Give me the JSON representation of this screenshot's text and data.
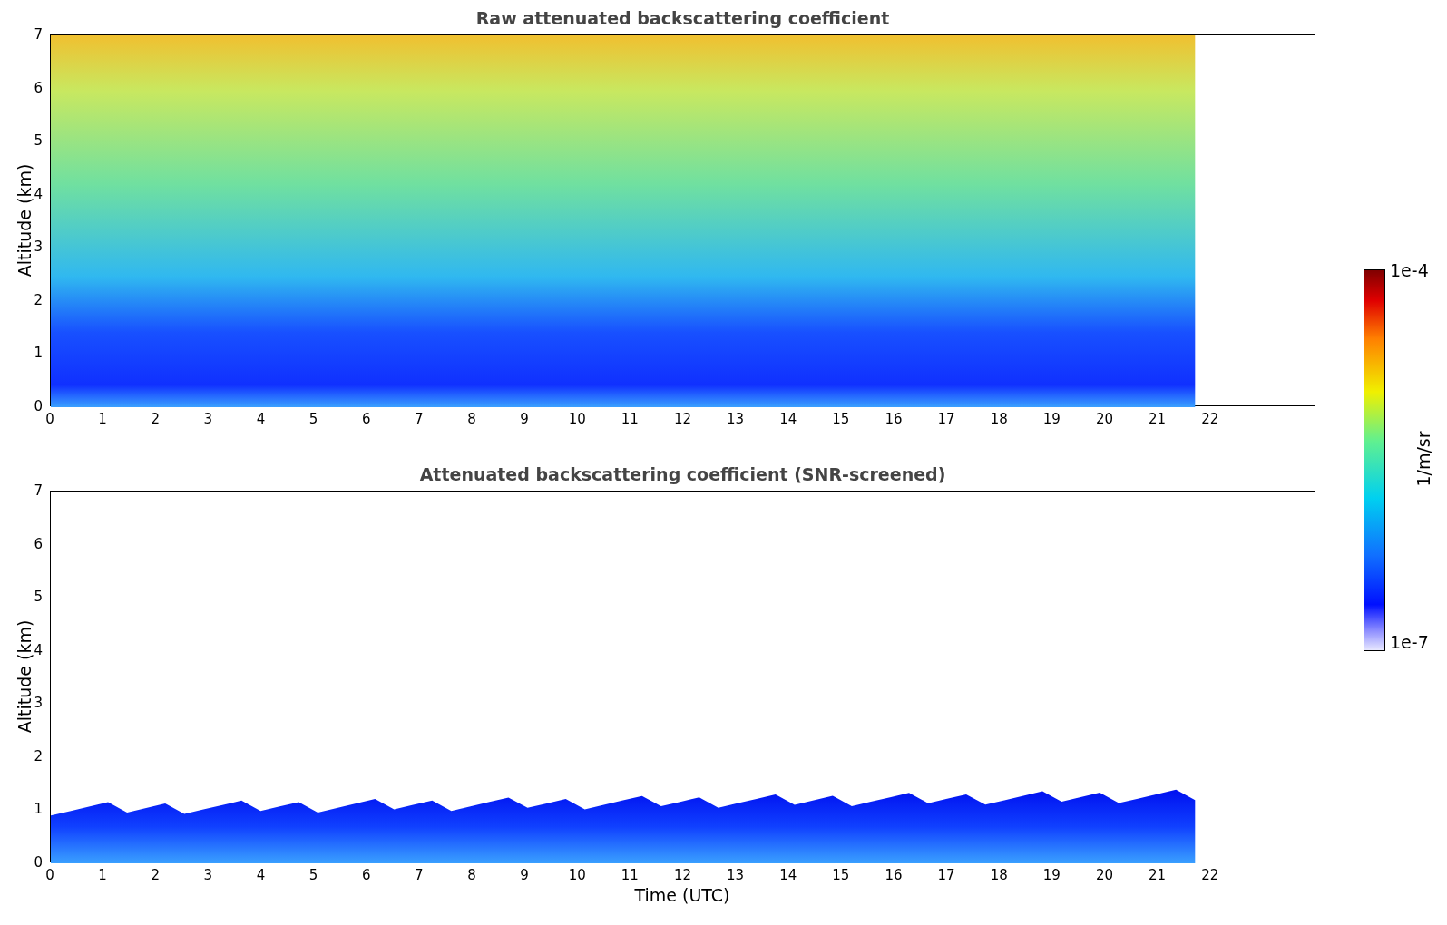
{
  "plots": [
    {
      "kind": "raw",
      "title": "Raw attenuated backscattering coefficient",
      "ylabel": "Altitude (km)",
      "yticks": [
        "7",
        "6",
        "5",
        "4",
        "3",
        "2",
        "1",
        "0"
      ],
      "xticks": [
        "0",
        "1",
        "2",
        "3",
        "4",
        "5",
        "6",
        "7",
        "8",
        "9",
        "10",
        "11",
        "12",
        "13",
        "14",
        "15",
        "16",
        "17",
        "18",
        "19",
        "20",
        "21",
        "22"
      ]
    },
    {
      "kind": "screened",
      "title": "Attenuated backscattering coefficient (SNR-screened)",
      "ylabel": "Altitude (km)",
      "yticks": [
        "7",
        "6",
        "5",
        "4",
        "3",
        "2",
        "1",
        "0"
      ],
      "xticks": [
        "0",
        "1",
        "2",
        "3",
        "4",
        "5",
        "6",
        "7",
        "8",
        "9",
        "10",
        "11",
        "12",
        "13",
        "14",
        "15",
        "16",
        "17",
        "18",
        "19",
        "20",
        "21",
        "22"
      ],
      "xlabel": "Time (UTC)"
    }
  ],
  "colorbar": {
    "max_label": "1e-4",
    "min_label": "1e-7",
    "unit": "1/m/sr"
  }
}
